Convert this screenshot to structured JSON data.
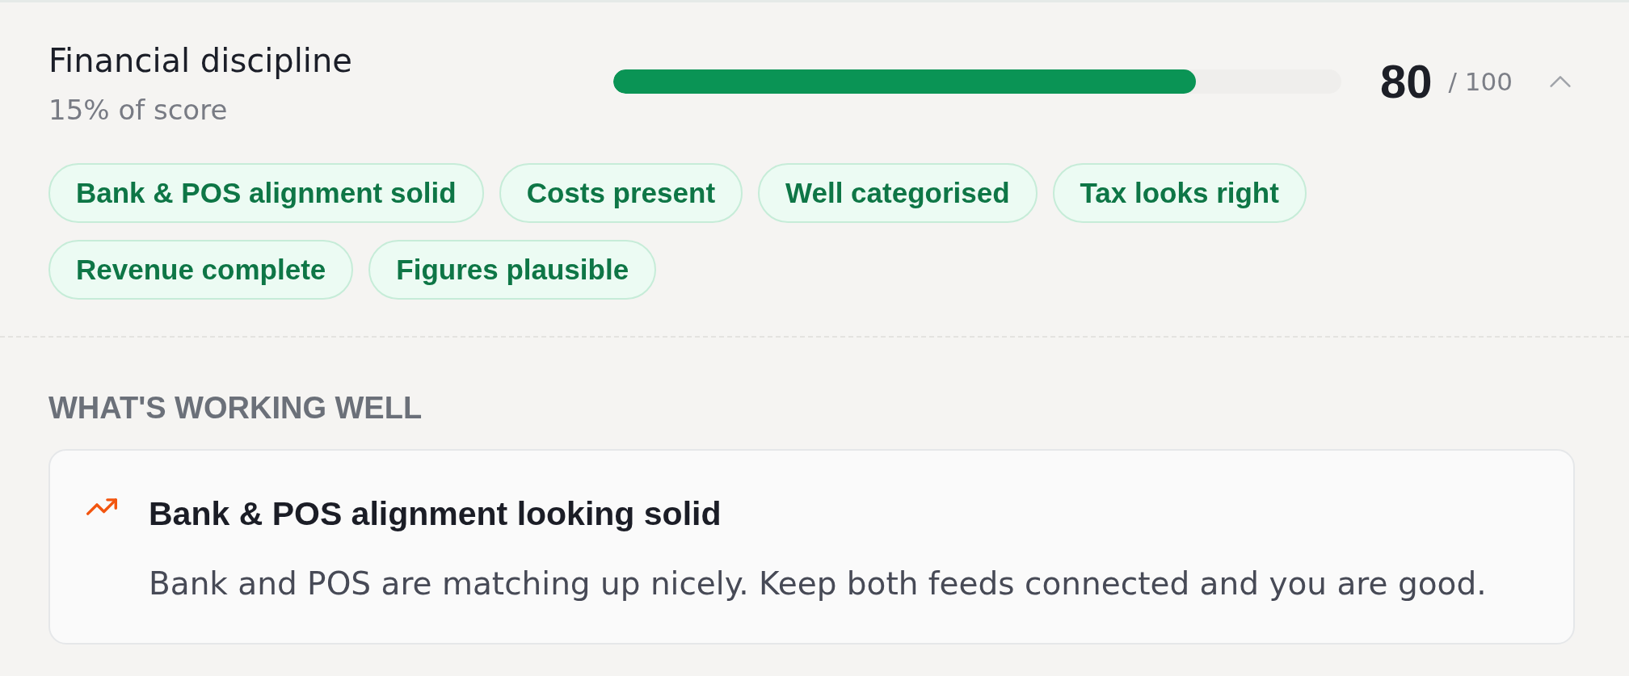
{
  "category": {
    "title": "Financial discipline",
    "weight": "15% of score",
    "level": 0.8,
    "score": "80",
    "max": "/ 100",
    "expanded": true
  },
  "tags": [
    "Bank & POS alignment solid",
    "Costs present",
    "Well categorised",
    "Tax looks right",
    "Revenue complete",
    "Figures plausible"
  ],
  "section": {
    "heading": "WHAT'S WORKING WELL",
    "items": [
      {
        "title": "Bank & POS alignment looking solid",
        "body": "Bank and POS are matching up nicely. Keep both feeds connected and you are good."
      }
    ]
  }
}
